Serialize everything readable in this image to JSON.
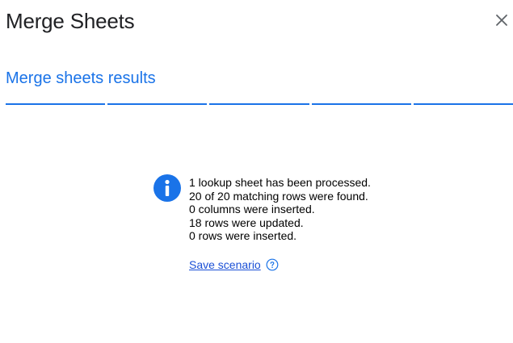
{
  "dialog": {
    "title": "Merge Sheets",
    "close_icon": "close-icon"
  },
  "section": {
    "title": "Merge sheets results"
  },
  "stepper": {
    "steps_total": 5,
    "steps_completed": 5,
    "accent_color": "#1a73e8"
  },
  "results": {
    "icon": "info-icon",
    "icon_color": "#1a73e8",
    "lines": [
      "1 lookup sheet has been processed.",
      "20 of 20 matching rows were found.",
      "0 columns were inserted.",
      "18 rows were updated.",
      "0 rows were inserted."
    ]
  },
  "actions": {
    "save_scenario_label": "Save scenario",
    "help_icon": "help-circle-icon",
    "link_color": "#1a4fd6"
  }
}
